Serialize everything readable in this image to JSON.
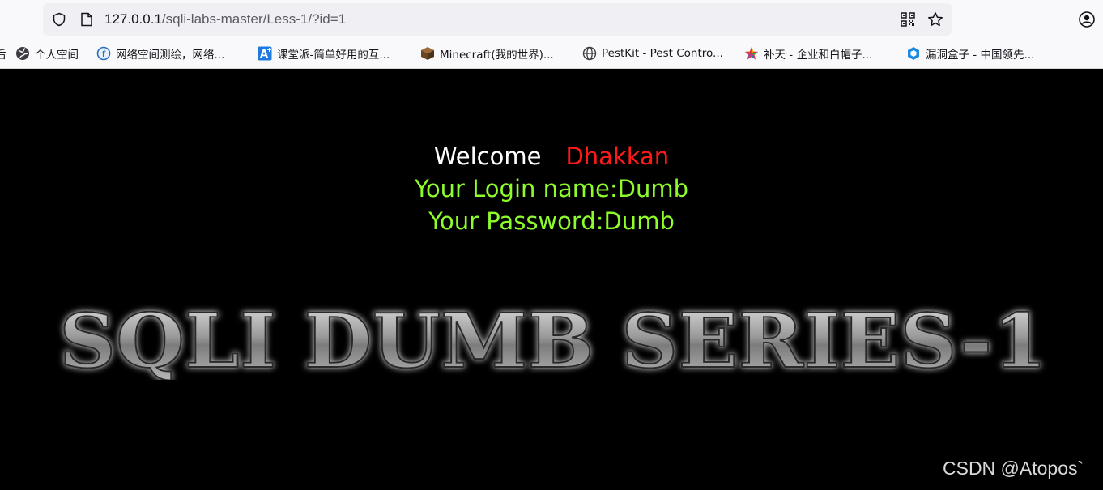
{
  "browser": {
    "url_host": "127.0.0.1",
    "url_rest": "/sqli-labs-master/Less-1/?id=1",
    "bookmarks": [
      {
        "label": "后",
        "icon": "none"
      },
      {
        "label": "个人空间",
        "icon": "globe-icon"
      },
      {
        "label": "网络空间测绘，网络...",
        "icon": "fofa-icon"
      },
      {
        "label": "课堂派-简单好用的互...",
        "icon": "ketangpai-icon"
      },
      {
        "label": "Minecraft(我的世界)...",
        "icon": "minecraft-icon"
      },
      {
        "label": "PestKit - Pest Contro...",
        "icon": "globe-icon"
      },
      {
        "label": "补天 - 企业和白帽子...",
        "icon": "butian-icon"
      },
      {
        "label": "漏洞盒子 - 中国领先...",
        "icon": "vulbox-icon"
      }
    ]
  },
  "page": {
    "welcome": "Welcome",
    "username_display": "Dhakkan",
    "login_line": "Your Login name:Dumb",
    "password_line": "Your Password:Dumb",
    "banner_text": "SQLI DUMB SERIES-1",
    "watermark": "CSDN @Atopos`"
  },
  "colors": {
    "welcome": "#ffffff",
    "name": "#ff1a1a",
    "credentials": "#8efc2b",
    "background": "#000000"
  }
}
